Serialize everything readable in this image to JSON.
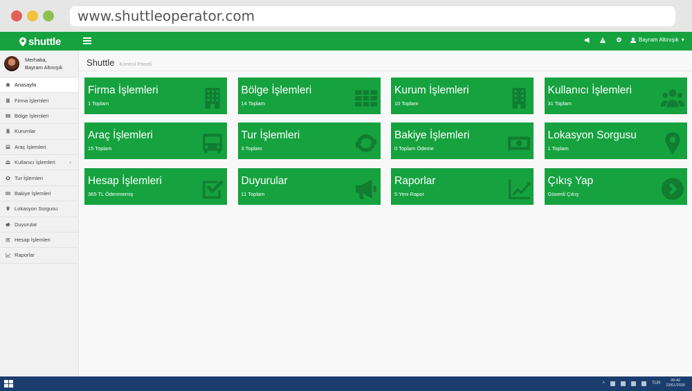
{
  "browser": {
    "url": "www.shuttleoperator.com"
  },
  "header": {
    "logo_text": "shuttle",
    "user_name": "Bayram Altınışık",
    "brand_color": "#16a23f"
  },
  "sidebar": {
    "greeting": "Merhaba,",
    "user_name": "Bayram Altınışık",
    "items": [
      {
        "label": "Anasayfa",
        "icon": "home-icon"
      },
      {
        "label": "Firma İşlemleri",
        "icon": "building-icon"
      },
      {
        "label": "Bölge İşlemleri",
        "icon": "grid-icon"
      },
      {
        "label": "Kurumlar",
        "icon": "office-icon"
      },
      {
        "label": "Araç İşlemleri",
        "icon": "bus-icon"
      },
      {
        "label": "Kullanıcı İşlemleri",
        "icon": "users-icon"
      },
      {
        "label": "Tur İşlemleri",
        "icon": "refresh-icon"
      },
      {
        "label": "Bakiye İşlemleri",
        "icon": "money-icon"
      },
      {
        "label": "Lokasyon Sorgusu",
        "icon": "map-marker-icon"
      },
      {
        "label": "Duyurular",
        "icon": "bullhorn-icon"
      },
      {
        "label": "Hesap İşlemleri",
        "icon": "check-square-icon"
      },
      {
        "label": "Raporlar",
        "icon": "line-chart-icon"
      }
    ]
  },
  "page": {
    "title": "Shuttle",
    "subtitle": "Kontrol Paneli"
  },
  "tiles": [
    {
      "title": "Firma İşlemleri",
      "sub": "1 Toplam",
      "icon": "building-icon"
    },
    {
      "title": "Bölge İşlemleri",
      "sub": "14 Toplam",
      "icon": "grid-icon"
    },
    {
      "title": "Kurum İşlemleri",
      "sub": "10 Toplam",
      "icon": "office-icon"
    },
    {
      "title": "Kullanıcı İşlemleri",
      "sub": "31 Toplam",
      "icon": "users-icon"
    },
    {
      "title": "Araç İşlemleri",
      "sub": "15 Toplam",
      "icon": "bus-icon"
    },
    {
      "title": "Tur İşlemleri",
      "sub": "3 Toplam",
      "icon": "refresh-icon"
    },
    {
      "title": "Bakiye İşlemleri",
      "sub": "0 Toplam Ödeme",
      "icon": "money-icon"
    },
    {
      "title": "Lokasyon Sorgusu",
      "sub": "1 Toplam",
      "icon": "map-marker-icon"
    },
    {
      "title": "Hesap İşlemleri",
      "sub": "365 TL Ödenmemiş",
      "icon": "check-square-icon"
    },
    {
      "title": "Duyurular",
      "sub": "11 Toplam",
      "icon": "bullhorn-icon"
    },
    {
      "title": "Raporlar",
      "sub": "5 Yeni Rapor",
      "icon": "line-chart-icon"
    },
    {
      "title": "Çıkış Yap",
      "sub": "Güvenli Çıkış",
      "icon": "arrow-circle-right-icon"
    }
  ],
  "taskbar": {
    "lang": "TUR",
    "time": "00:42",
    "date": "23/01/2016"
  }
}
